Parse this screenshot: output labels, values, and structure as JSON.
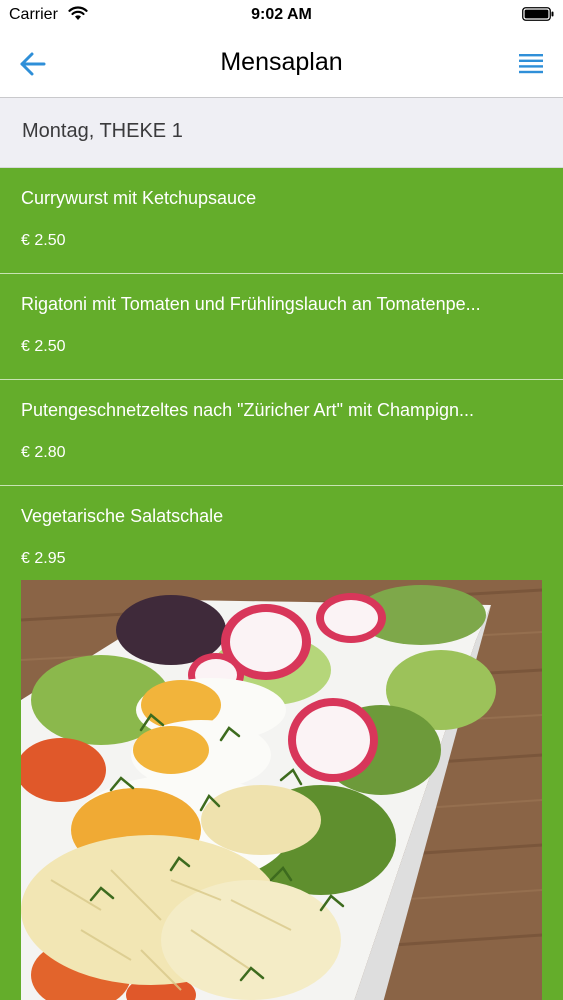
{
  "status_bar": {
    "carrier": "Carrier",
    "time": "9:02 AM",
    "wifi_icon": "wifi-icon",
    "battery_icon": "battery-icon"
  },
  "nav": {
    "title": "Mensaplan",
    "back_icon": "arrow-left-icon",
    "menu_icon": "list-menu-icon",
    "accent_color": "#2f8fd8"
  },
  "section": {
    "title": "Montag, THEKE 1"
  },
  "colors": {
    "list_background": "#64ad2b",
    "header_background": "#efeff4"
  },
  "menu_items": [
    {
      "name": "Currywurst mit Ketchupsauce",
      "price": "€ 2.50"
    },
    {
      "name": "Rigatoni mit Tomaten und Frühlingslauch an Tomatenpe...",
      "price": "€ 2.50"
    },
    {
      "name": "Putengeschnetzeltes nach \"Züricher Art\" mit Champign...",
      "price": "€ 2.80"
    },
    {
      "name": "Vegetarische Salatschale",
      "price": "€ 2.95",
      "image": "salad-bowl-photo"
    }
  ]
}
